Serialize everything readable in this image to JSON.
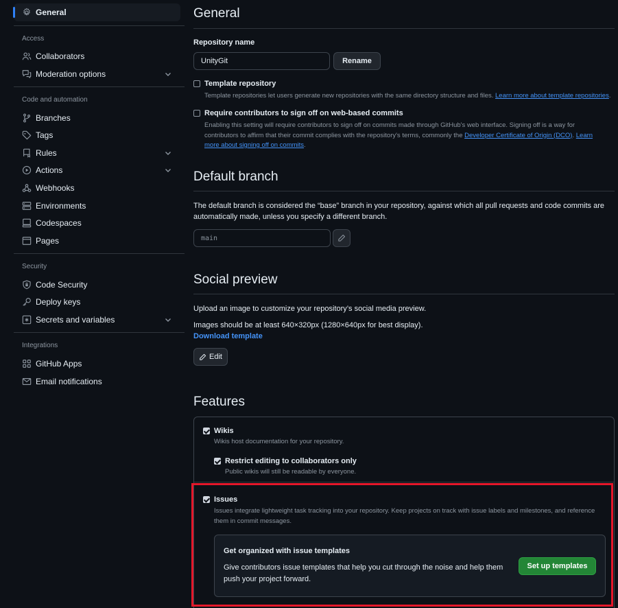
{
  "sidebar": {
    "active_item": {
      "label": "General",
      "icon": "gear-icon"
    },
    "sections": {
      "access": {
        "title": "Access",
        "items": [
          {
            "label": "Collaborators",
            "icon": "people-icon"
          },
          {
            "label": "Moderation options",
            "icon": "comment-discussion-icon",
            "expandable": true
          }
        ]
      },
      "code": {
        "title": "Code and automation",
        "items": [
          {
            "label": "Branches",
            "icon": "git-branch-icon"
          },
          {
            "label": "Tags",
            "icon": "tag-icon"
          },
          {
            "label": "Rules",
            "icon": "repo-push-icon",
            "expandable": true
          },
          {
            "label": "Actions",
            "icon": "play-icon",
            "expandable": true
          },
          {
            "label": "Webhooks",
            "icon": "webhook-icon"
          },
          {
            "label": "Environments",
            "icon": "server-icon"
          },
          {
            "label": "Codespaces",
            "icon": "codespaces-icon"
          },
          {
            "label": "Pages",
            "icon": "browser-icon"
          }
        ]
      },
      "security": {
        "title": "Security",
        "items": [
          {
            "label": "Code Security",
            "icon": "shield-lock-icon"
          },
          {
            "label": "Deploy keys",
            "icon": "key-icon"
          },
          {
            "label": "Secrets and variables",
            "icon": "key-asterisk-icon",
            "expandable": true
          }
        ]
      },
      "integrations": {
        "title": "Integrations",
        "items": [
          {
            "label": "GitHub Apps",
            "icon": "apps-icon"
          },
          {
            "label": "Email notifications",
            "icon": "mail-icon"
          }
        ]
      }
    }
  },
  "general": {
    "title": "General",
    "repo_name_label": "Repository name",
    "repo_name_value": "UnityGit",
    "rename_button": "Rename",
    "template_repo": {
      "title": "Template repository",
      "description": "Template repositories let users generate new repositories with the same directory structure and files.",
      "link": "Learn more about template repositories",
      "link_suffix": ".",
      "checked": false
    },
    "signoff": {
      "title": "Require contributors to sign off on web-based commits",
      "description": "Enabling this setting will require contributors to sign off on commits made through GitHub's web interface. Signing off is a way for contributors to affirm that their commit complies with the repository's terms, commonly the",
      "link1": "Developer Certificate of Origin (DCO)",
      "middle": ".",
      "link2": "Learn more about signing off on commits",
      "end": ".",
      "checked": false
    }
  },
  "default_branch": {
    "title": "Default branch",
    "description": "The default branch is considered the “base” branch in your repository, against which all pull requests and code commits are automatically made, unless you specify a different branch.",
    "branch": "main",
    "edit_icon": "pencil-icon"
  },
  "social_preview": {
    "title": "Social preview",
    "line1": "Upload an image to customize your repository’s social media preview.",
    "line2": "Images should be at least 640×320px (1280×640px for best display).",
    "download_link": "Download template",
    "edit_button": "Edit"
  },
  "features": {
    "title": "Features",
    "wikis": {
      "title": "Wikis",
      "description": "Wikis host documentation for your repository.",
      "checked": true,
      "restrict": {
        "title": "Restrict editing to collaborators only",
        "description": "Public wikis will still be readable by everyone.",
        "checked": true
      }
    },
    "issues": {
      "title": "Issues",
      "description": "Issues integrate lightweight task tracking into your repository. Keep projects on track with issue labels and milestones, and reference them in commit messages.",
      "checked": true,
      "templates": {
        "title": "Get organized with issue templates",
        "description": "Give contributors issue templates that help you cut through the noise and help them push your project forward.",
        "button": "Set up templates"
      }
    }
  },
  "colors": {
    "background": "#0d1117",
    "accent": "#2f81f7",
    "link": "#4493f8",
    "green_button": "#238636",
    "highlight": "#e5172a"
  }
}
